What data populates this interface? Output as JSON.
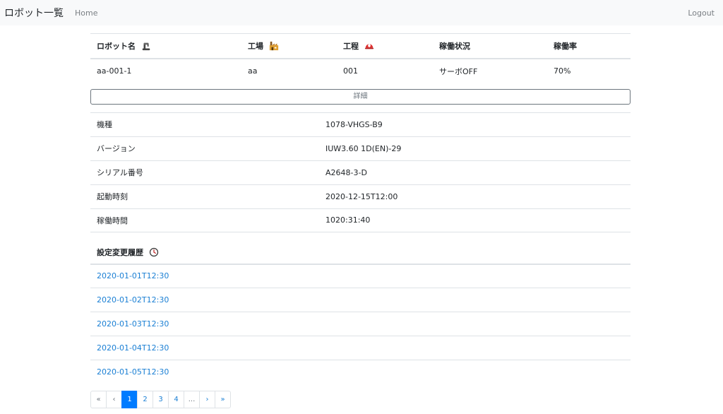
{
  "navbar": {
    "brand": "ロボット一覧",
    "home": "Home",
    "logout": "Logout"
  },
  "summary": {
    "headers": [
      "ロボット名",
      "工場",
      "工程",
      "稼働状況",
      "稼働率"
    ],
    "header_icons": [
      "arm-icon",
      "factory-icon",
      "helmet-icon"
    ],
    "row": [
      "aa-001-1",
      "aa",
      "001",
      "サーボOFF",
      "70%"
    ]
  },
  "detail_button": "詳細",
  "details": [
    {
      "label": "機種",
      "value": "1078-VHGS-B9"
    },
    {
      "label": "バージョン",
      "value": "IUW3.60 1D(EN)-29"
    },
    {
      "label": "シリアル番号",
      "value": "A2648-3-D"
    },
    {
      "label": "起動時刻",
      "value": "2020-12-15T12:00"
    },
    {
      "label": "稼働時間",
      "value": "1020:31:40"
    }
  ],
  "history": {
    "title": "設定変更履歴",
    "icon": "clock-icon",
    "items": [
      "2020-01-01T12:30",
      "2020-01-02T12:30",
      "2020-01-03T12:30",
      "2020-01-04T12:30",
      "2020-01-05T12:30"
    ]
  },
  "pagination": [
    "«",
    "‹",
    "1",
    "2",
    "3",
    "4",
    "...",
    "›",
    "»"
  ],
  "colors": {
    "link": "#1a7fd4",
    "active": "#007bff",
    "navbar": "#f8f9fa"
  }
}
